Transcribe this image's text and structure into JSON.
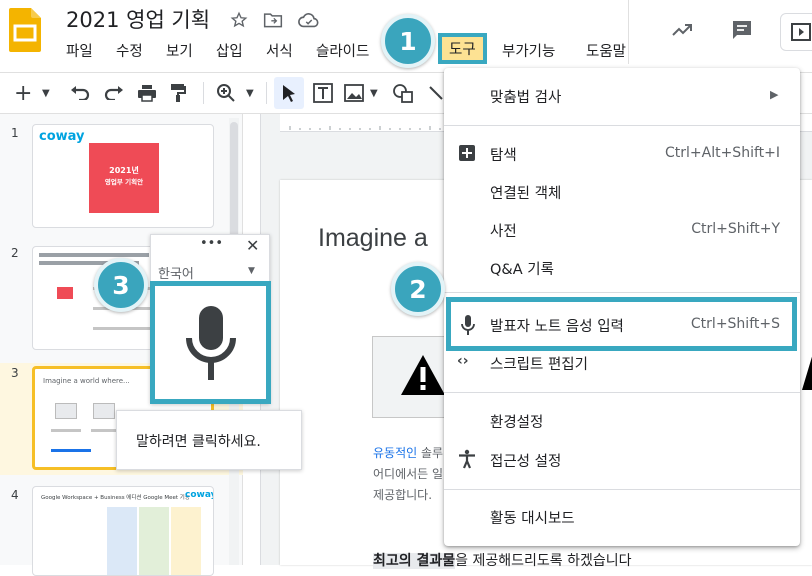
{
  "header": {
    "title": "2021 영업 기획",
    "menu": [
      "파일",
      "수정",
      "보기",
      "삽입",
      "서식",
      "슬라이드",
      "도구",
      "부가기능",
      "도움말"
    ]
  },
  "filmstrip": {
    "slides": [
      {
        "number": "1",
        "brand": "coway",
        "title_line1": "2021년",
        "title_line2": "영업부 기획안"
      },
      {
        "number": "2"
      },
      {
        "number": "3",
        "caption": "Imagine a world where..."
      },
      {
        "number": "4",
        "brand": "coway",
        "caption": "Google Workspace + Business 에디션 Google Meet 기능"
      }
    ]
  },
  "canvas": {
    "heading": "Imagine a",
    "body_link": "유동적인",
    "body_line1": " 솔루",
    "body_line2": "어디에서든 일",
    "body_line3": "제공합니다.",
    "bottom_text_bold": "최고의 결과물",
    "bottom_text_rest": "을 제공해드리도록 하겠습니다"
  },
  "tools_menu": {
    "items": [
      {
        "label": "맞춤법 검사",
        "shortcut": "",
        "icon": "",
        "submenu": true
      },
      {
        "label": "탐색",
        "shortcut": "Ctrl+Alt+Shift+I",
        "icon": "explore-icon"
      },
      {
        "label": "연결된 객체",
        "shortcut": ""
      },
      {
        "label": "사전",
        "shortcut": "Ctrl+Shift+Y"
      },
      {
        "label": "Q&A 기록",
        "shortcut": ""
      },
      {
        "label": "발표자 노트 음성 입력",
        "shortcut": "Ctrl+Shift+S",
        "icon": "mic-icon"
      },
      {
        "label": "스크립트 편집기",
        "shortcut": "",
        "icon": "code-icon"
      },
      {
        "label": "환경설정",
        "shortcut": ""
      },
      {
        "label": "접근성 설정",
        "shortcut": "",
        "icon": "accessibility-icon"
      },
      {
        "label": "활동 대시보드",
        "shortcut": ""
      }
    ]
  },
  "voice_panel": {
    "dots": "•••",
    "close": "✕",
    "language": "한국어",
    "tooltip": "말하려면 클릭하세요."
  },
  "callouts": [
    "1",
    "2",
    "3"
  ],
  "colors": {
    "callout": "#3aa5bd",
    "active_menu_bg": "#fde293",
    "selected_slide_border": "#f6bf26",
    "slides_logo": "#f4b400"
  }
}
